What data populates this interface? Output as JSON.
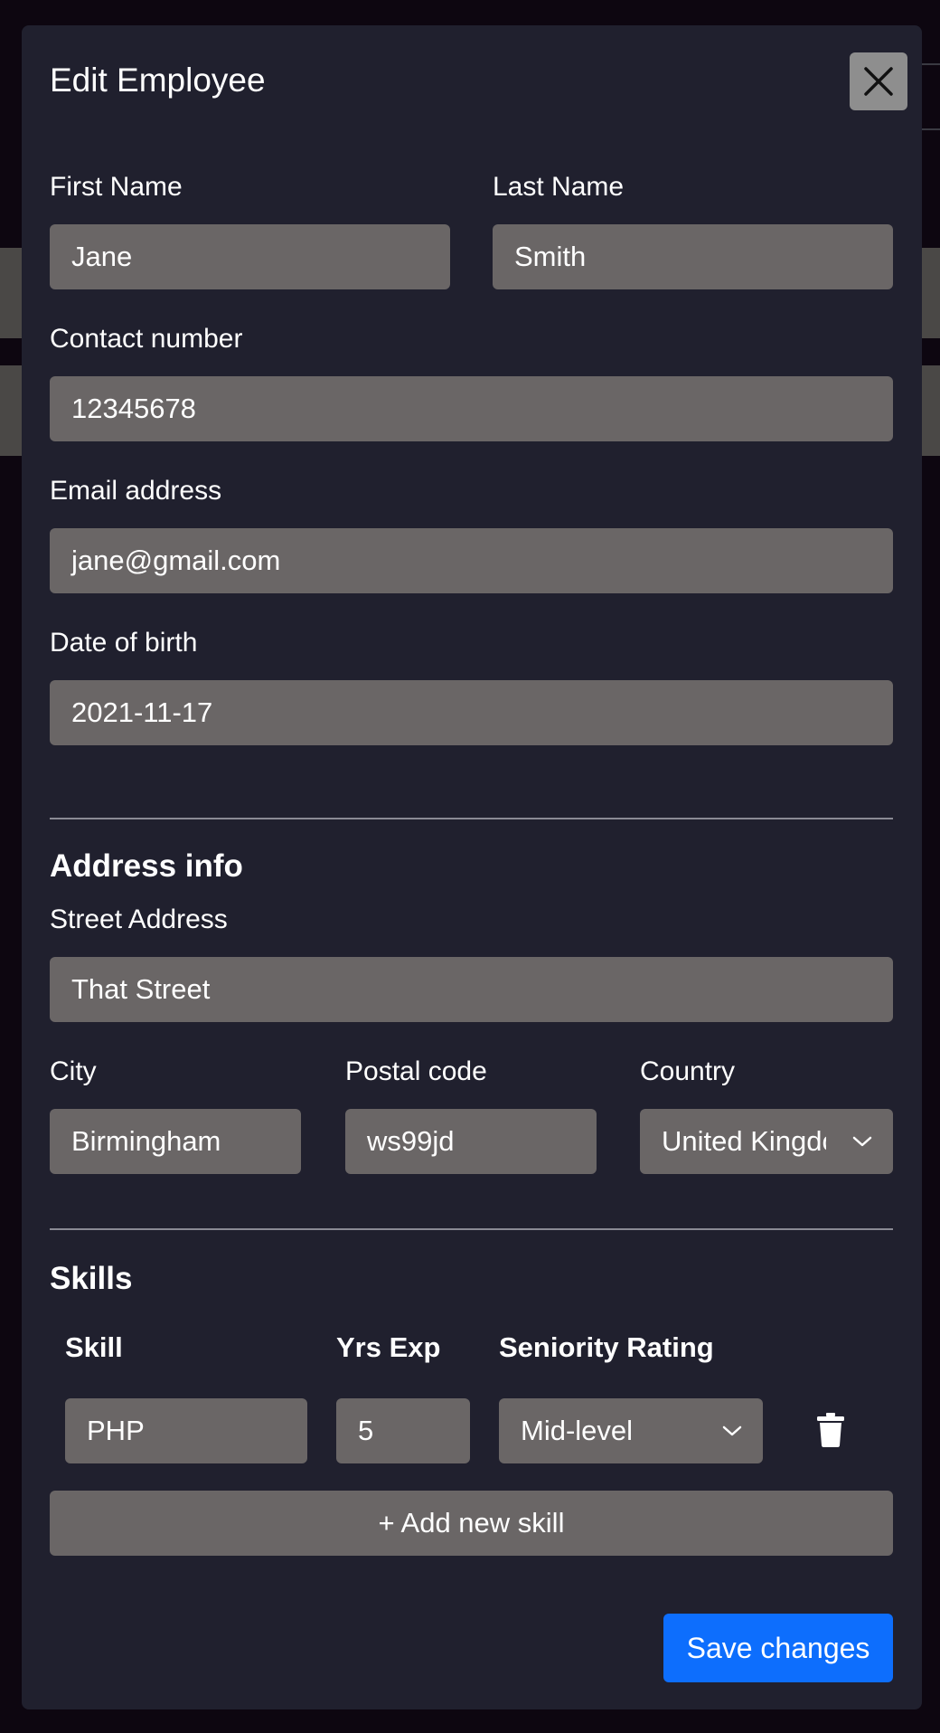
{
  "modal": {
    "title": "Edit Employee",
    "close_icon": "close-icon"
  },
  "personal": {
    "first_name_label": "First Name",
    "first_name_value": "Jane",
    "last_name_label": "Last Name",
    "last_name_value": "Smith",
    "contact_label": "Contact number",
    "contact_value": "12345678",
    "email_label": "Email address",
    "email_value": "jane@gmail.com",
    "dob_label": "Date of birth",
    "dob_value": "2021-11-17"
  },
  "address": {
    "section_title": "Address info",
    "street_label": "Street Address",
    "street_value": "That Street",
    "city_label": "City",
    "city_value": "Birmingham",
    "postal_label": "Postal code",
    "postal_value": "ws99jd",
    "country_label": "Country",
    "country_value": "United Kingdom"
  },
  "skills": {
    "section_title": "Skills",
    "headers": {
      "skill": "Skill",
      "years": "Yrs Exp",
      "seniority": "Seniority Rating"
    },
    "rows": [
      {
        "skill": "PHP",
        "years": "5",
        "seniority": "Mid-level",
        "delete_icon": "trash-icon"
      }
    ],
    "add_label": "+ Add new skill"
  },
  "footer": {
    "save_label": "Save changes"
  },
  "colors": {
    "backdrop": "#0d0610",
    "modal": "#20202e",
    "field": "#6a6666",
    "primary": "#0d6efd"
  }
}
